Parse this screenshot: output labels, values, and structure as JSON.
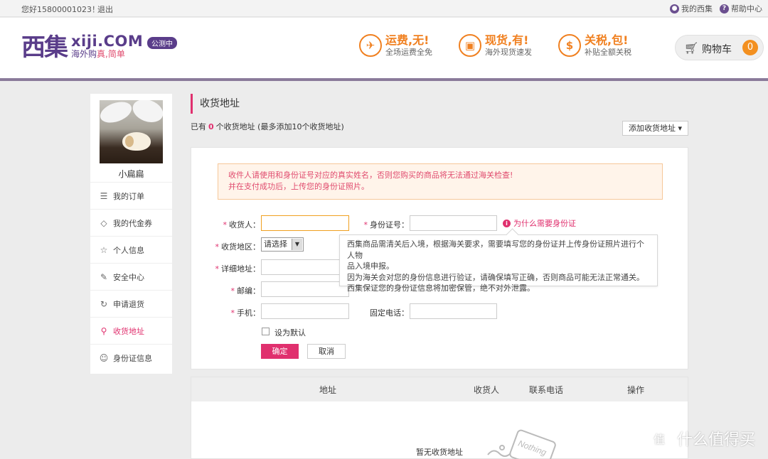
{
  "topbar": {
    "greeting": "您好15800001023！",
    "logout": "退出",
    "my_xiji": "我的西集",
    "help": "帮助中心"
  },
  "header": {
    "logo_mark": "西集",
    "brand": "xiji.COM",
    "slogan_pre": "海外购",
    "slogan_hl": "真,简单",
    "beta": "公测中",
    "promos": [
      {
        "icon": "plane-icon",
        "title": "运费,无!",
        "sub": "全场运费全免"
      },
      {
        "icon": "gift-icon",
        "title": "现货,有!",
        "sub": "海外现货速发"
      },
      {
        "icon": "money-icon",
        "title": "关税,包!",
        "sub": "补贴全额关税"
      }
    ],
    "cart_label": "购物车",
    "cart_count": "0"
  },
  "sidebar": {
    "username": "小扁扁",
    "items": [
      {
        "label": "我的订单",
        "icon": "list-icon",
        "glyph": "☰"
      },
      {
        "label": "我的代金券",
        "icon": "tag-icon",
        "glyph": "◇"
      },
      {
        "label": "个人信息",
        "icon": "star-icon",
        "glyph": "☆"
      },
      {
        "label": "安全中心",
        "icon": "edit-icon",
        "glyph": "✎"
      },
      {
        "label": "申请退货",
        "icon": "refresh-icon",
        "glyph": "↻"
      },
      {
        "label": "收货地址",
        "icon": "location-icon",
        "glyph": "⚲"
      },
      {
        "label": "身份证信息",
        "icon": "id-card-icon",
        "glyph": "☺"
      }
    ]
  },
  "main": {
    "title": "收货地址",
    "count_prefix": "已有",
    "count": "0",
    "count_suffix": "个收货地址",
    "count_note": "(最多添加10个收货地址)",
    "add_button": "添加收货地址 ▾",
    "warning_line1": "收件人请使用和身份证号对应的真实姓名，否则您购买的商品将无法通过海关检查!",
    "warning_line2": "并在支付成功后，上传您的身份证照片。",
    "form": {
      "recipient_label": "收货人：",
      "id_label": "身份证号：",
      "region_label": "收货地区：",
      "region_value": "请选择",
      "address_label": "详细地址：",
      "zip_label": "邮编：",
      "mobile_label": "手机：",
      "phone_label": "固定电话：",
      "why_id": "为什么需要身份证",
      "default_label": "设为默认",
      "confirm": "确定",
      "cancel": "取消"
    },
    "tip_lines": [
      "西集商品需清关后入境，根据海关要求，需要填写您的身份证并上传身份证照片进行个人物",
      "品入境申报。",
      "因为海关会对您的身份信息进行验证，请确保填写正确，否则商品可能无法正常通关。",
      "西集保证您的身份证信息将加密保管，绝不对外泄露。"
    ],
    "table": {
      "col_address": "地址",
      "col_recipient": "收货人",
      "col_phone": "联系电话",
      "col_action": "操作",
      "empty": "暂无收货地址",
      "stamp": "Nothing"
    }
  },
  "watermark": "值 什么值得买"
}
